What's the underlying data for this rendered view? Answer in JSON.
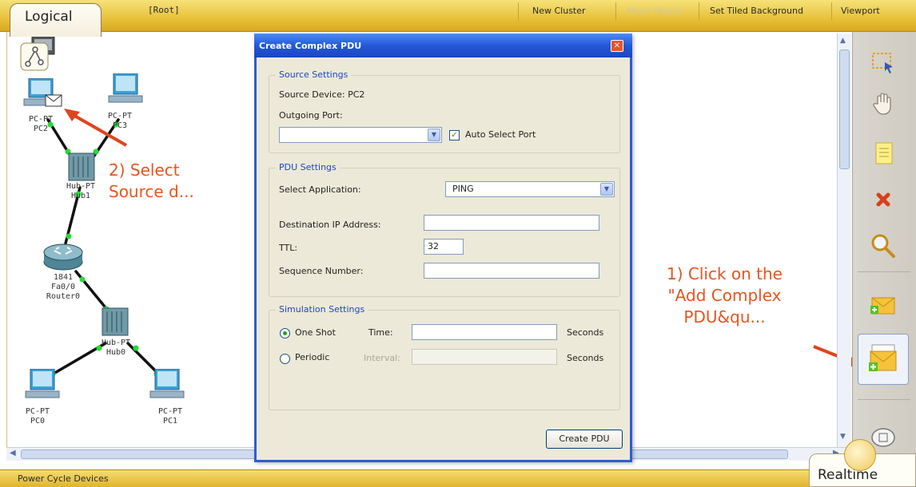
{
  "toolbar": {
    "logical_tab": "Logical",
    "root": "[Root]",
    "new_cluster": "New Cluster",
    "move_object": "Move Object",
    "set_tiled_background": "Set Tiled Background",
    "viewport": "Viewport"
  },
  "network": {
    "pc2": [
      "PC-PT",
      "PC2"
    ],
    "pc3": [
      "PC-PT",
      "PC3"
    ],
    "hub1": [
      "Hub-PT",
      "Hub1"
    ],
    "router": [
      "1841",
      "Fa0/0",
      "Router0"
    ],
    "hub0": [
      "Hub-PT",
      "Hub0"
    ],
    "pc0": [
      "PC-PT",
      "PC0"
    ],
    "pc1": [
      "PC-PT",
      "PC1"
    ]
  },
  "annotations": {
    "select_source": [
      "2) Select",
      "Source d..."
    ],
    "click_add": [
      "1) Click on the",
      "\"Add Complex",
      "PDU&qu..."
    ]
  },
  "dialog": {
    "title": "Create Complex PDU",
    "source_settings": {
      "title": "Source Settings",
      "source_device": "Source Device: PC2",
      "outgoing_port_label": "Outgoing Port:",
      "outgoing_port_value": "",
      "auto_select_port": "Auto Select Port",
      "auto_select_checked": true
    },
    "pdu_settings": {
      "title": "PDU Settings",
      "select_application_label": "Select Application:",
      "select_application_value": "PING",
      "destination_ip_label": "Destination IP Address:",
      "destination_ip_value": "",
      "ttl_label": "TTL:",
      "ttl_value": "32",
      "sequence_number_label": "Sequence Number:",
      "sequence_number_value": ""
    },
    "simulation_settings": {
      "title": "Simulation Settings",
      "one_shot": "One Shot",
      "time_label": "Time:",
      "time_value": "",
      "seconds_1": "Seconds",
      "periodic": "Periodic",
      "interval_label": "Interval:",
      "interval_value": "",
      "seconds_2": "Seconds",
      "selected": "one_shot"
    },
    "create_button": "Create PDU"
  },
  "bottom": {
    "power_cycle": "Power Cycle Devices",
    "realtime": "Realtime"
  },
  "palette_icons": [
    "select-icon",
    "hand-move-icon",
    "place-note-icon",
    "delete-icon",
    "inspect-icon",
    "add-simple-pdu-icon",
    "add-complex-pdu-icon",
    "resize-shape-icon"
  ],
  "colors": {
    "annotation": "#e8541e",
    "link": "#111111",
    "link_light": "#22dd33",
    "dialog_title": "#2358d8",
    "toolbar": "#e8c13a"
  }
}
